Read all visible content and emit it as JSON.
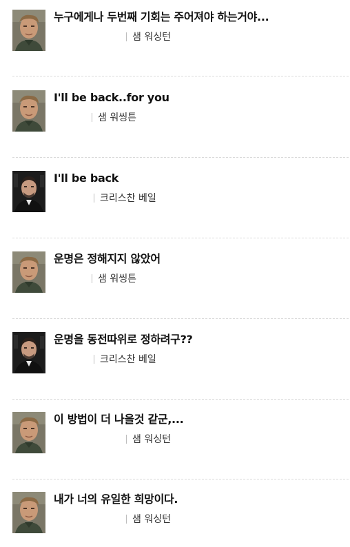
{
  "items": [
    {
      "title": "누구에게나 두번째 기회는 주어져야 하는거야...",
      "author": "샘 워싱턴",
      "avatar": "sam-avatar"
    },
    {
      "title": "I'll be back..for you",
      "author": "샘 워씽튼",
      "avatar": "sam-avatar"
    },
    {
      "title": "I'll be back",
      "author": "크리스찬 베일",
      "avatar": "christian-avatar"
    },
    {
      "title": "운명은 정해지지 않았어",
      "author": "샘 워씽튼",
      "avatar": "sam-avatar"
    },
    {
      "title": "운명을 동전따위로 정하려구??",
      "author": "크리스찬 베일",
      "avatar": "christian-avatar"
    },
    {
      "title": "이 방법이 더 나을것 같군,...",
      "author": "샘 워싱턴",
      "avatar": "sam-avatar"
    },
    {
      "title": "내가 너의 유일한 희망이다.",
      "author": "샘 워싱턴",
      "avatar": "sam-avatar"
    }
  ]
}
